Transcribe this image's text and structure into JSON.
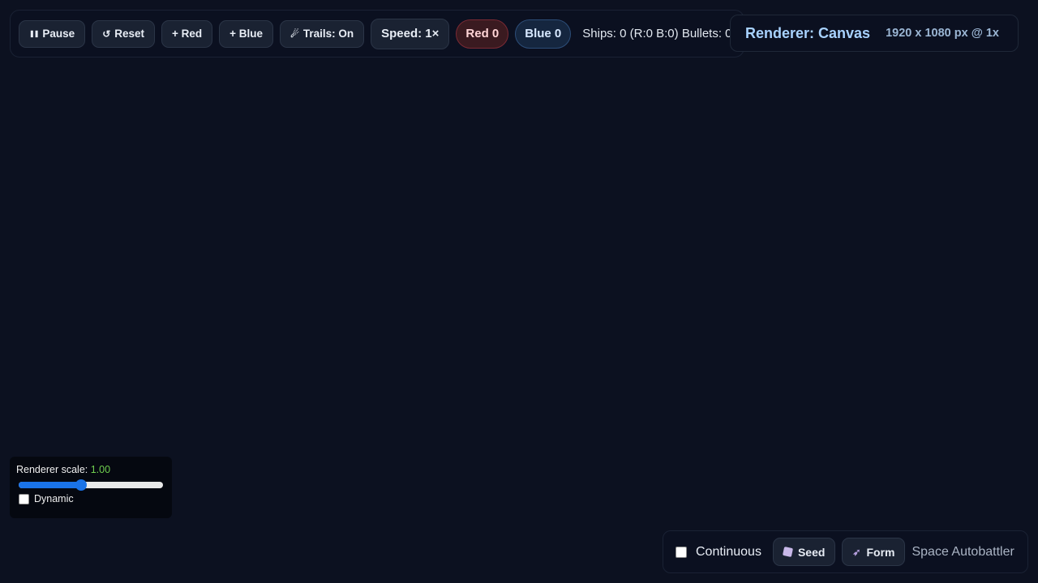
{
  "toolbar": {
    "pause_label": "Pause",
    "pause_icon": "❚❚",
    "reset_label": "Reset",
    "reset_icon": "↺",
    "add_red_label": "+ Red",
    "add_blue_label": "+ Blue",
    "trails_label": "Trails: On",
    "trails_icon": "☄",
    "speed_label": "Speed: 1×",
    "red_score": "Red 0",
    "blue_score": "Blue 0",
    "stats_text": "Ships: 0 (R:0 B:0) Bullets: 0"
  },
  "renderer": {
    "title": "Renderer: Canvas",
    "resolution": "1920 x 1080 px @ 1x"
  },
  "scale_panel": {
    "label": "Renderer scale: ",
    "value": "1.00",
    "slider_fraction": 0.43,
    "dynamic_label": "Dynamic",
    "dynamic_checked": false
  },
  "bottom_bar": {
    "continuous_label": "Continuous",
    "continuous_checked": false,
    "seed_label": "Seed",
    "form_label": "Form",
    "brand": "Space Autobattler"
  },
  "colors": {
    "background": "#0c1120",
    "red_team": "#7a2a34",
    "blue_team": "#2c4d78",
    "slider_accent": "#1a73e8",
    "scale_value": "#6fcf4f"
  },
  "icons": {
    "pause": "pause-icon",
    "reset": "reset-icon",
    "trails": "comet-icon",
    "seed": "dice-icon",
    "form": "rocket-icon"
  }
}
